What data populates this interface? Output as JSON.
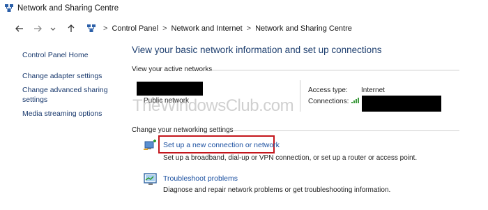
{
  "window": {
    "title": "Network and Sharing Centre"
  },
  "nav": {
    "breadcrumbs": [
      "Control Panel",
      "Network and Internet",
      "Network and Sharing Centre"
    ],
    "separator": ">"
  },
  "sidebar": {
    "home": "Control Panel Home",
    "items": [
      {
        "label": "Change adapter settings"
      },
      {
        "label": "Change advanced sharing settings"
      },
      {
        "label": "Media streaming options"
      }
    ]
  },
  "main": {
    "title": "View your basic network information and set up connections",
    "active_networks_header": "View your active networks",
    "network_type": "Public network",
    "access_type_label": "Access type:",
    "access_type_value": "Internet",
    "connections_label": "Connections:",
    "watermark": "TheWindowsClub.com",
    "change_settings_header": "Change your networking settings",
    "tasks": [
      {
        "icon": "new-connection-icon",
        "label": "Set up a new connection or network",
        "desc": "Set up a broadband, dial-up or VPN connection, or set up a router or access point."
      },
      {
        "icon": "troubleshoot-icon",
        "label": "Troubleshoot problems",
        "desc": "Diagnose and repair network problems or get troubleshooting information."
      }
    ]
  },
  "colors": {
    "link": "#1a4fa0",
    "title": "#1e3f6f",
    "highlight": "#c4161c"
  }
}
